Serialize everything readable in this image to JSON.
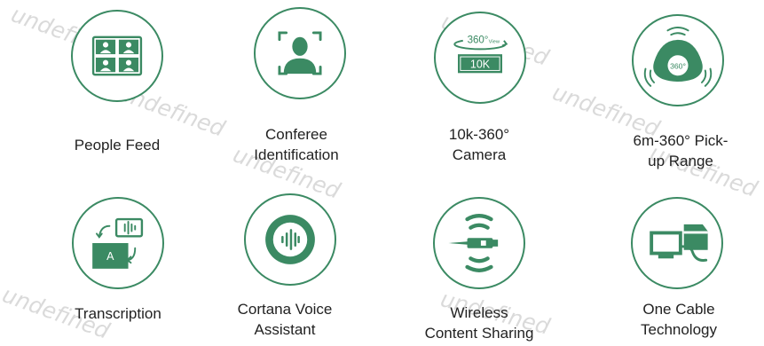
{
  "features": [
    {
      "label": "People Feed",
      "icon": "people-feed-icon"
    },
    {
      "label": "Conferee\nIdentification",
      "icon": "conferee-identification-icon"
    },
    {
      "label": "10k-360°\nCamera",
      "icon": "camera-360-icon"
    },
    {
      "label": "6m-360° Pick-\nup Range",
      "icon": "pickup-range-icon"
    },
    {
      "label": "Transcription",
      "icon": "transcription-icon"
    },
    {
      "label": "Cortana Voice\nAssistant",
      "icon": "voice-assistant-icon"
    },
    {
      "label": "Wireless\nContent Sharing",
      "icon": "wireless-sharing-icon"
    },
    {
      "label": "One Cable\nTechnology",
      "icon": "one-cable-icon"
    }
  ],
  "icon_text": {
    "view360": "360°",
    "view_suffix": "View",
    "resolution": "10K",
    "mic360": "360°",
    "transcript_letter": "A"
  },
  "watermark": "undefined",
  "colors": {
    "accent": "#3b8a63",
    "text": "#222222",
    "watermark": "#969696"
  }
}
